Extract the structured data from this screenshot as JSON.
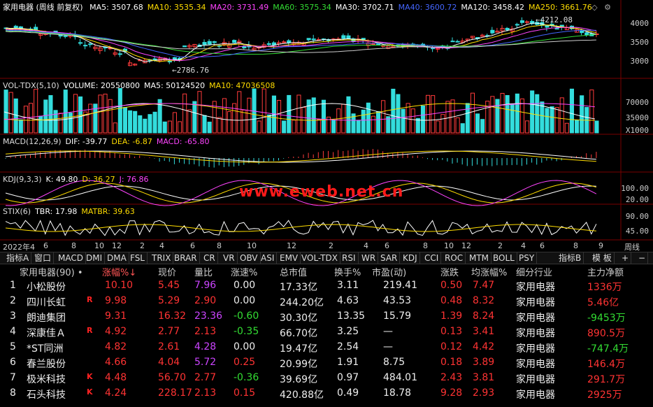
{
  "main_header": {
    "title": "家用电器 (周线 前复权)",
    "ma": [
      {
        "label": "MA5: 3507.68",
        "color": "#ffffff"
      },
      {
        "label": "MA10: 3535.34",
        "color": "#ffdd00"
      },
      {
        "label": "MA20: 3731.49",
        "color": "#ff44ff"
      },
      {
        "label": "MA60: 3575.34",
        "color": "#33dd33"
      },
      {
        "label": "MA30: 3702.71",
        "color": "#ffffff"
      },
      {
        "label": "MA40: 3600.72",
        "color": "#4466ff"
      },
      {
        "label": "MA120: 3458.42",
        "color": "#ffffff"
      },
      {
        "label": "MA250: 3661.76",
        "color": "#ffdd00"
      }
    ],
    "yticks": [
      "4000",
      "3500",
      "3000"
    ],
    "high_label": "4212.08",
    "low_label": "2786.76"
  },
  "vol_header": {
    "items": [
      {
        "label": "VOL-TDX(5,10)",
        "color": "#dddddd"
      },
      {
        "label": "VOLUME: 20550800",
        "color": "#ffffff"
      },
      {
        "label": "MA5: 50124520",
        "color": "#ffffff"
      },
      {
        "label": "MA10: 47036508",
        "color": "#ffdd00"
      }
    ],
    "yticks": [
      "70000",
      "35000"
    ],
    "unit": "X1000"
  },
  "macd_header": {
    "items": [
      {
        "label": "MACD(12,26,9)",
        "color": "#dddddd"
      },
      {
        "label": "DIF: -39.77",
        "color": "#ffffff"
      },
      {
        "label": "DEA: -6.87",
        "color": "#ffdd00"
      },
      {
        "label": "MACD: -65.80",
        "color": "#ff44ff"
      }
    ]
  },
  "kdj_header": {
    "items": [
      {
        "label": "KDJ(9,3,3)",
        "color": "#dddddd"
      },
      {
        "label": "K: 49.80",
        "color": "#ffffff"
      },
      {
        "label": "D: 36.27",
        "color": "#ffdd00"
      },
      {
        "label": "J: 76.86",
        "color": "#ff44ff"
      }
    ],
    "yticks": [
      "100.00",
      "20.00"
    ]
  },
  "stix_header": {
    "items": [
      {
        "label": "STIX(6)",
        "color": "#dddddd"
      },
      {
        "label": "TBR: 17.98",
        "color": "#ffffff"
      },
      {
        "label": "MATBR: 39.63",
        "color": "#ffdd00"
      }
    ],
    "yticks": [
      "90.00",
      "45.00"
    ]
  },
  "watermark": "www.eweb.net.cn",
  "xaxis": {
    "labels": [
      "2022年4",
      "6",
      "8",
      "10",
      "12",
      "2",
      "4",
      "6",
      "8",
      "10",
      "12",
      "2",
      "4",
      "6",
      "8",
      "10",
      "12",
      "2",
      "4",
      "6",
      "8",
      "9"
    ],
    "right_label": "周线"
  },
  "tabs": [
    "指标A",
    "窗口",
    "MACD",
    "DMI",
    "DMA",
    "FSL",
    "TRIX",
    "BRAR",
    "CR",
    "VR",
    "OBV",
    "ASI",
    "EMV",
    "VOL-TDX",
    "RSI",
    "WR",
    "SAR",
    "KDJ",
    "CCI",
    "ROC",
    "MTM",
    "BOLL",
    "PSY",
    "指标B",
    "模 板",
    "+",
    "−"
  ],
  "table": {
    "headers": [
      "家用电器(90) •",
      "涨幅%↓",
      "现价",
      "量比",
      "涨速%",
      "总市值",
      "换手%",
      "市盈(动)",
      "涨跌",
      "均涨幅%",
      "细分行业",
      "主力净额"
    ],
    "rows": [
      {
        "no": "1",
        "name": "小松股份",
        "flag": "",
        "pct": "10.10",
        "price": "5.45",
        "vr": "7.96",
        "speed": "0.00",
        "cap": "17.33亿",
        "turn": "3.11",
        "pe": "219.41",
        "chg": "0.50",
        "avg": "7.47",
        "ind": "家用电器",
        "flow": "1336万",
        "speed_c": "white",
        "vr_c": "purple",
        "flow_c": "red"
      },
      {
        "no": "2",
        "name": "四川长虹",
        "flag": "R",
        "pct": "9.98",
        "price": "5.29",
        "vr": "2.90",
        "speed": "0.00",
        "cap": "244.20亿",
        "turn": "4.63",
        "pe": "43.53",
        "chg": "0.48",
        "avg": "8.32",
        "ind": "家用电器",
        "flow": "5.46亿",
        "speed_c": "white",
        "vr_c": "red",
        "flow_c": "red"
      },
      {
        "no": "3",
        "name": "朗迪集团",
        "flag": "",
        "pct": "9.31",
        "price": "16.32",
        "vr": "23.36",
        "speed": "-0.60",
        "cap": "30.30亿",
        "turn": "13.35",
        "pe": "15.79",
        "chg": "1.39",
        "avg": "8.24",
        "ind": "家用电器",
        "flow": "-9453万",
        "speed_c": "green",
        "vr_c": "purple",
        "flow_c": "green"
      },
      {
        "no": "4",
        "name": "深康佳Ａ",
        "flag": "R",
        "pct": "4.92",
        "price": "2.77",
        "vr": "2.13",
        "speed": "-0.35",
        "cap": "66.70亿",
        "turn": "3.25",
        "pe": "—",
        "chg": "0.13",
        "avg": "3.41",
        "ind": "家用电器",
        "flow": "890.5万",
        "speed_c": "green",
        "vr_c": "red",
        "flow_c": "red"
      },
      {
        "no": "5",
        "name": "*ST同洲",
        "flag": "",
        "pct": "4.82",
        "price": "2.61",
        "vr": "4.28",
        "speed": "0.00",
        "cap": "19.47亿",
        "turn": "2.54",
        "pe": "—",
        "chg": "0.12",
        "avg": "4.42",
        "ind": "家用电器",
        "flow": "-747.4万",
        "speed_c": "white",
        "vr_c": "purple",
        "flow_c": "green"
      },
      {
        "no": "6",
        "name": "春兰股份",
        "flag": "",
        "pct": "4.66",
        "price": "4.04",
        "vr": "5.72",
        "speed": "0.25",
        "cap": "20.99亿",
        "turn": "1.91",
        "pe": "8.75",
        "chg": "0.18",
        "avg": "3.89",
        "ind": "家用电器",
        "flow": "146.4万",
        "speed_c": "red",
        "vr_c": "purple",
        "flow_c": "red"
      },
      {
        "no": "7",
        "name": "极米科技",
        "flag": "K",
        "pct": "4.48",
        "price": "56.70",
        "vr": "2.77",
        "speed": "-0.36",
        "cap": "39.69亿",
        "turn": "0.97",
        "pe": "484.01",
        "chg": "2.43",
        "avg": "3.81",
        "ind": "家用电器",
        "flow": "291.7万",
        "speed_c": "green",
        "vr_c": "red",
        "flow_c": "red"
      },
      {
        "no": "8",
        "name": "石头科技",
        "flag": "K",
        "pct": "4.24",
        "price": "228.17",
        "vr": "2.13",
        "speed": "0.15",
        "cap": "420.88亿",
        "turn": "0.49",
        "pe": "18.78",
        "chg": "9.28",
        "avg": "2.93",
        "ind": "家用电器",
        "flow": "2925万",
        "speed_c": "red",
        "vr_c": "red",
        "flow_c": "red"
      }
    ]
  }
}
